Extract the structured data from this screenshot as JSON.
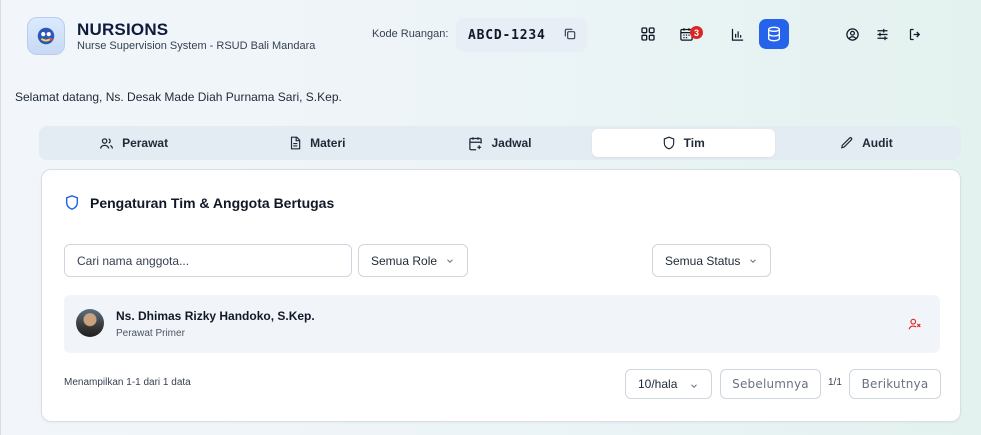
{
  "header": {
    "brand_name": "NURSIONS",
    "brand_sub": "Nurse Supervision System - RSUD Bali Mandara",
    "room_label": "Kode Ruangan:",
    "room_code": "ABCD-1234",
    "calendar_badge": "3",
    "icons": [
      "grid-icon",
      "calendar-icon",
      "chart-icon",
      "database-icon",
      "user-circle-icon",
      "sliders-icon",
      "logout-icon"
    ],
    "accent_color": "#2563eb"
  },
  "welcome": "Selamat datang, Ns. Desak Made Diah Purnama Sari, S.Kep.",
  "tabs": [
    {
      "label": "Perawat",
      "icon": "users-icon"
    },
    {
      "label": "Materi",
      "icon": "document-icon"
    },
    {
      "label": "Jadwal",
      "icon": "calendar-plus-icon"
    },
    {
      "label": "Tim",
      "icon": "shield-icon",
      "active": true
    },
    {
      "label": "Audit",
      "icon": "pencil-icon"
    }
  ],
  "card": {
    "title": "Pengaturan Tim & Anggota Bertugas",
    "search_placeholder": "Cari nama anggota...",
    "role_filter": "Semua Role",
    "status_filter": "Semua Status",
    "members": [
      {
        "name": "Ns. Dhimas Rizky Handoko, S.Kep.",
        "role": "Perawat Primer"
      }
    ],
    "footer_info": "Menampilkan 1-1 dari 1 data",
    "page_size": "10/hala",
    "prev_label": "Sebelumnya",
    "page_indicator": "1/1",
    "next_label": "Berikutnya"
  }
}
